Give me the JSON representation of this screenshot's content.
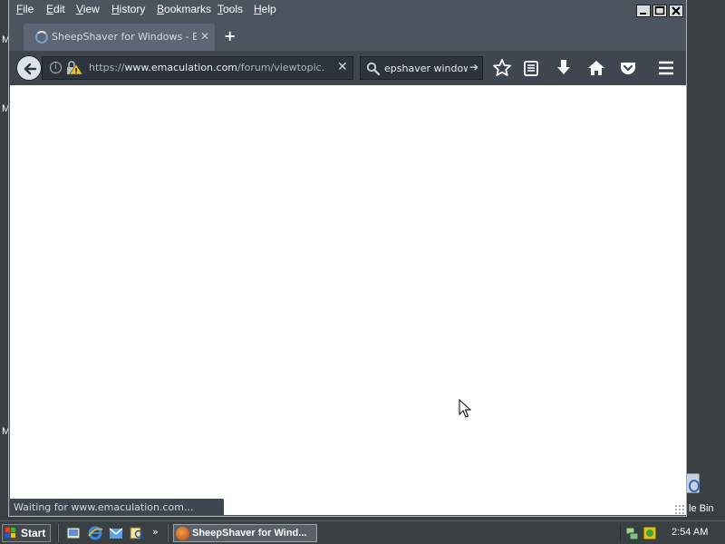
{
  "menubar": {
    "items": [
      "File",
      "Edit",
      "View",
      "History",
      "Bookmarks",
      "Tools",
      "Help"
    ],
    "underline": [
      "F",
      "E",
      "V",
      "H",
      "B",
      "T",
      "H"
    ],
    "rest": [
      "ile",
      "dit",
      "iew",
      "istory",
      "ookmarks",
      "ools",
      "elp"
    ]
  },
  "tab": {
    "title": "SheepShaver for Windows - E...",
    "close_icon": "close-icon",
    "loading": true
  },
  "urlbar": {
    "scheme": "https://",
    "host": "www.emaculation.com",
    "path": "/forum/viewtopic.p"
  },
  "searchbar": {
    "value": "epshaver windows"
  },
  "status": {
    "text": "Waiting for www.emaculation.com..."
  },
  "desktop": {
    "left_fragment_1": "M",
    "left_fragment_2": "M",
    "recycle_label": "le Bin"
  },
  "taskbar": {
    "start_label": "Start",
    "chevron": "»",
    "task_label": "SheepShaver for Wind...",
    "clock": "2:54 AM"
  },
  "colors": {
    "window_frame": "#4c5460",
    "accent_border": "#c8b060",
    "content_bg": "#ffffff"
  }
}
